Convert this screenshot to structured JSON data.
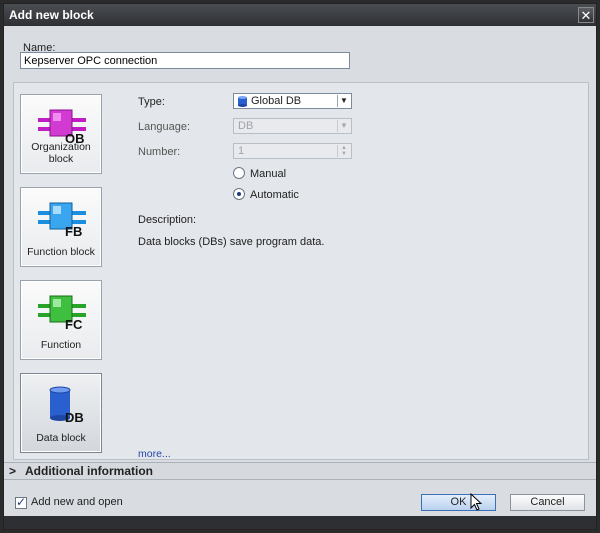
{
  "window": {
    "title": "Add new block",
    "close_glyph": "✕"
  },
  "name_field": {
    "label": "Name:",
    "value": "Kepserver OPC connection"
  },
  "block_types": [
    {
      "id": "ob",
      "badge": "OB",
      "label": "Organization block",
      "icon": "organization-block-icon",
      "color": "#c21cc4"
    },
    {
      "id": "fb",
      "badge": "FB",
      "label": "Function block",
      "icon": "function-block-icon",
      "color": "#1a8fe0"
    },
    {
      "id": "fc",
      "badge": "FC",
      "label": "Function",
      "icon": "function-icon",
      "color": "#28a428"
    },
    {
      "id": "db",
      "badge": "DB",
      "label": "Data block",
      "icon": "data-block-icon",
      "color": "#2a5fd0",
      "selected": true
    }
  ],
  "type": {
    "label": "Type:",
    "value": "Global DB"
  },
  "language": {
    "label": "Language:",
    "value": "DB"
  },
  "number": {
    "label": "Number:",
    "value": "1"
  },
  "numbering": {
    "manual_label": "Manual",
    "automatic_label": "Automatic",
    "selected": "automatic"
  },
  "description": {
    "label": "Description:",
    "text": "Data blocks (DBs) save program data."
  },
  "more_link": "more...",
  "additional_info": {
    "arrow": ">",
    "label": "Additional information"
  },
  "footer": {
    "add_new_and_open_label": "Add new and open",
    "add_new_and_open_checked": true,
    "ok_label": "OK",
    "cancel_label": "Cancel"
  }
}
